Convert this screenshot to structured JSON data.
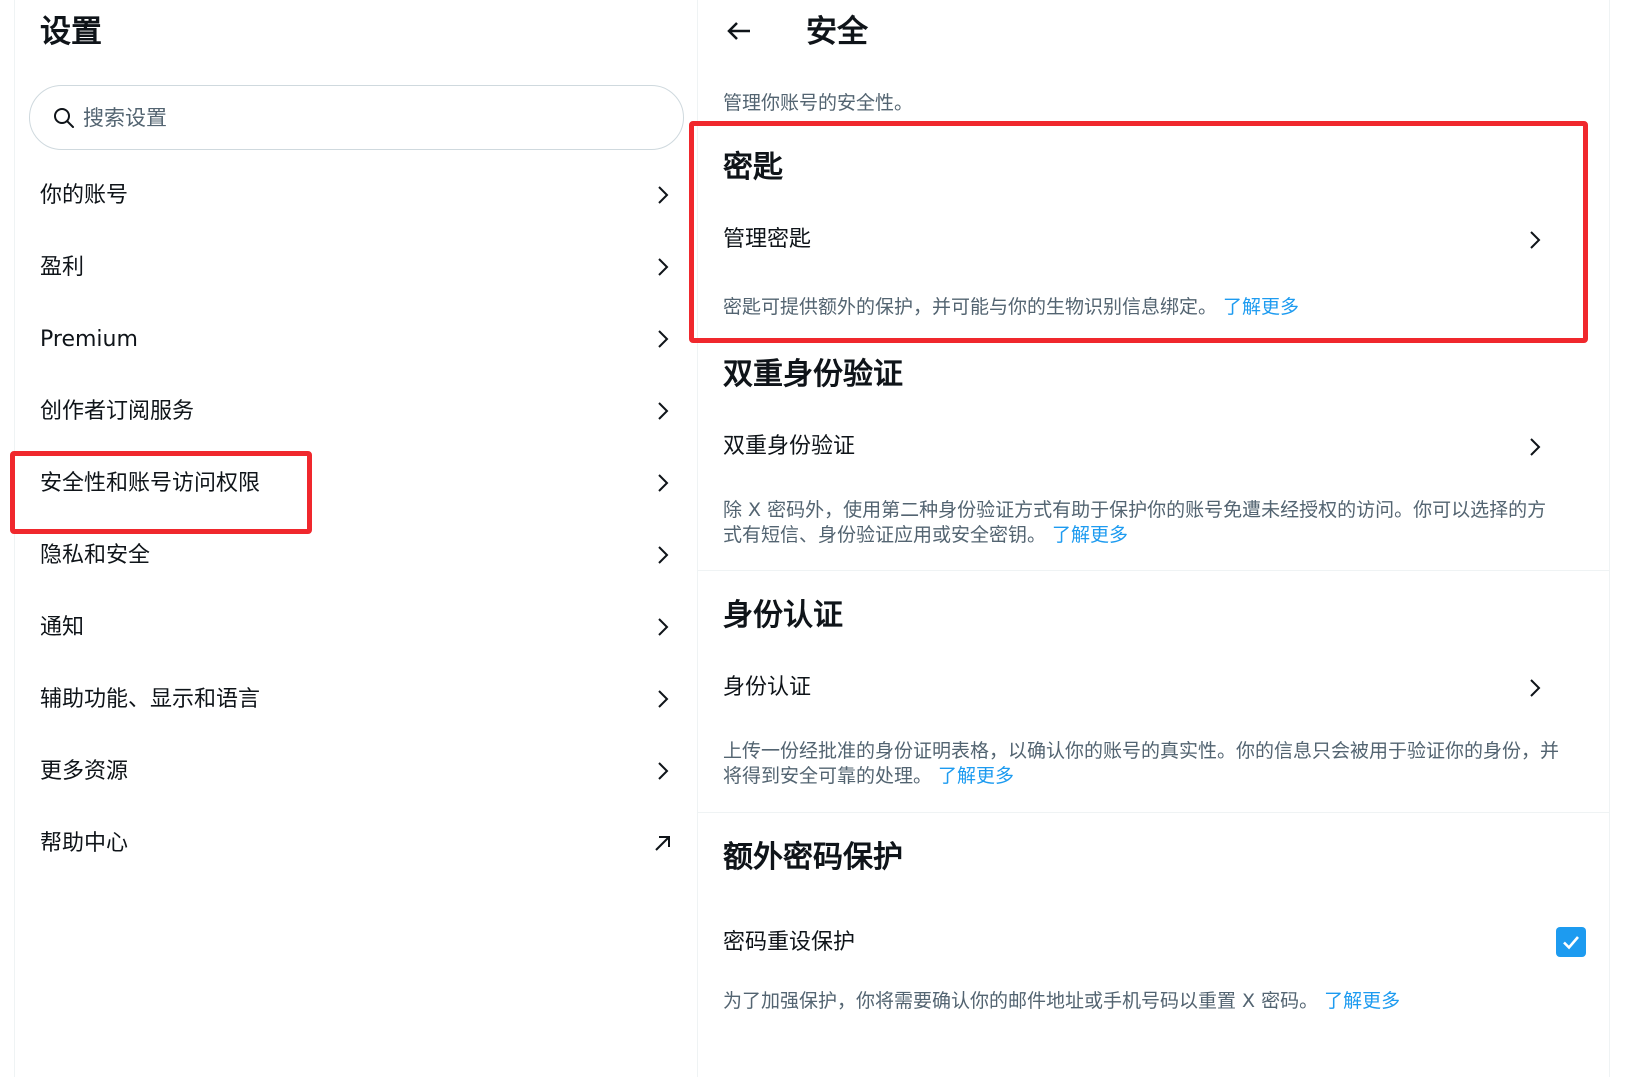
{
  "left": {
    "title": "设置",
    "search": {
      "placeholder": "搜索设置"
    },
    "nav_items": [
      {
        "label": "你的账号",
        "icon": "chevron-right-icon"
      },
      {
        "label": "盈利",
        "icon": "chevron-right-icon"
      },
      {
        "label": "Premium",
        "icon": "chevron-right-icon"
      },
      {
        "label": "创作者订阅服务",
        "icon": "chevron-right-icon"
      },
      {
        "label": "安全性和账号访问权限",
        "icon": "chevron-right-icon"
      },
      {
        "label": "隐私和安全",
        "icon": "chevron-right-icon"
      },
      {
        "label": "通知",
        "icon": "chevron-right-icon"
      },
      {
        "label": "辅助功能、显示和语言",
        "icon": "chevron-right-icon"
      },
      {
        "label": "更多资源",
        "icon": "chevron-right-icon"
      },
      {
        "label": "帮助中心",
        "icon": "external-link-arrow-icon"
      }
    ]
  },
  "right": {
    "title": "安全",
    "subtitle": "管理你账号的安全性。",
    "sections": {
      "passkey": {
        "title": "密匙",
        "row_label": "管理密匙",
        "desc": "密匙可提供额外的保护，并可能与你的生物识别信息绑定。",
        "learn_more": "了解更多"
      },
      "two_factor": {
        "title": "双重身份验证",
        "row_label": "双重身份验证",
        "desc": "除 X 密码外，使用第二种身份验证方式有助于保护你的账号免遭未经授权的访问。你可以选择的方式有短信、身份验证应用或安全密钥。",
        "learn_more": "了解更多"
      },
      "id_verification": {
        "title": "身份认证",
        "row_label": "身份认证",
        "desc": "上传一份经批准的身份证明表格，以确认你的账号的真实性。你的信息只会被用于验证你的身份，并将得到安全可靠的处理。",
        "learn_more": "了解更多"
      },
      "password_protection": {
        "title": "额外密码保护",
        "row_label": "密码重设保护",
        "checked": true,
        "desc": "为了加强保护，你将需要确认你的邮件地址或手机号码以重置 X 密码。",
        "learn_more": "了解更多"
      }
    }
  },
  "colors": {
    "accent": "#1d9bf0",
    "highlight": "#f0282d",
    "text_primary": "#0f1419",
    "text_secondary": "#536471"
  }
}
